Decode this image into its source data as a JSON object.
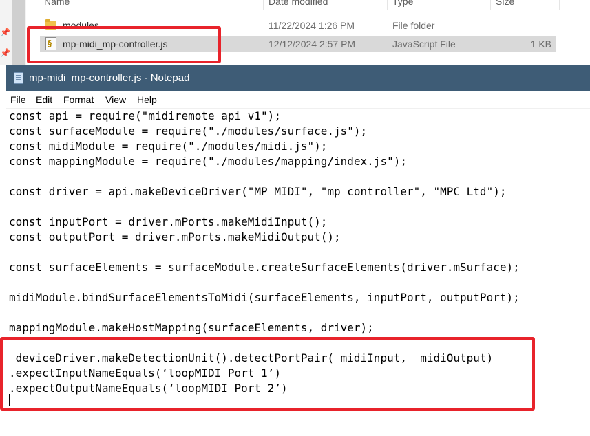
{
  "explorer": {
    "columns": {
      "name": "Name",
      "date_modified": "Date modified",
      "type": "Type",
      "size": "Size"
    },
    "rows": [
      {
        "name": "modules",
        "date": "11/22/2024 1:26 PM",
        "type": "File folder",
        "size": "",
        "icon": "folder-icon"
      },
      {
        "name": "mp-midi_mp-controller.js",
        "date": "12/12/2024 2:57 PM",
        "type": "JavaScript File",
        "size": "1 KB",
        "icon": "js-file-icon",
        "selected": true
      }
    ]
  },
  "notepad": {
    "title": "mp-midi_mp-controller.js - Notepad",
    "menu": [
      "File",
      "Edit",
      "Format",
      "View",
      "Help"
    ],
    "lines": [
      "const api = require(\"midiremote_api_v1\");",
      "const surfaceModule = require(\"./modules/surface.js\");",
      "const midiModule = require(\"./modules/midi.js\");",
      "const mappingModule = require(\"./modules/mapping/index.js\");",
      "",
      "const driver = api.makeDeviceDriver(\"MP MIDI\", \"mp controller\", \"MPC Ltd\");",
      "",
      "const inputPort = driver.mPorts.makeMidiInput();",
      "const outputPort = driver.mPorts.makeMidiOutput();",
      "",
      "const surfaceElements = surfaceModule.createSurfaceElements(driver.mSurface);",
      "",
      "midiModule.bindSurfaceElementsToMidi(surfaceElements, inputPort, outputPort);",
      "",
      "mappingModule.makeHostMapping(surfaceElements, driver);",
      "",
      "_deviceDriver.makeDetectionUnit().detectPortPair(_midiInput, _midiOutput)",
      ".expectInputNameEquals(‘loopMIDI Port 1’)",
      ".expectOutputNameEquals(‘loopMIDI Port 2’)"
    ]
  },
  "annotations": {
    "highlight_color": "#e8232b"
  }
}
